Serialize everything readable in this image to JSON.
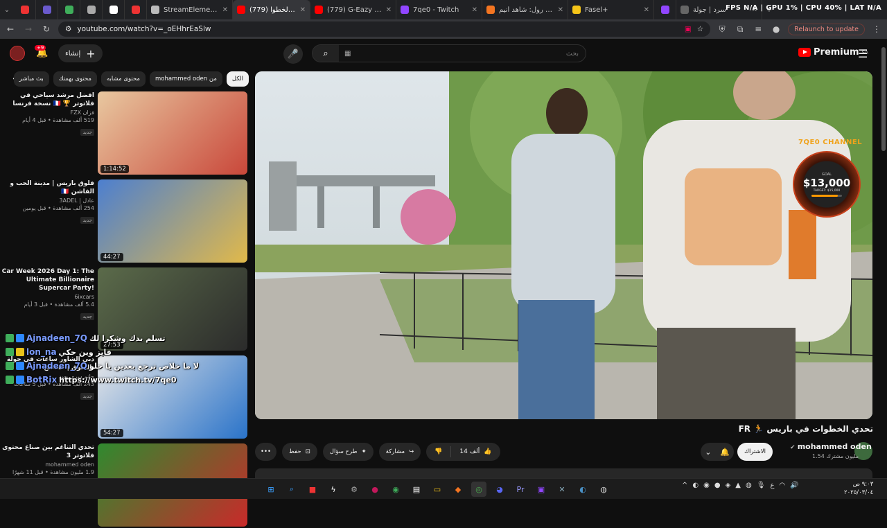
{
  "browser": {
    "tabs": [
      {
        "label": "",
        "fav": "#e33"
      },
      {
        "label": "",
        "fav": "#6a5acd"
      },
      {
        "label": "",
        "fav": "#3fae5b"
      },
      {
        "label": "",
        "fav": "#aaa"
      },
      {
        "label": "",
        "fav": "#fff"
      },
      {
        "label": "",
        "fav": "#e33"
      },
      {
        "label": "StreamElements - 7qe0",
        "fav": "#bbb"
      },
      {
        "label": "(779) تحدي الخطوا",
        "fav": "#f00",
        "active": true
      },
      {
        "label": "(779) G-Eazy x Bebe R",
        "fav": "#f00"
      },
      {
        "label": "7qe0 - Twitch",
        "fav": "#9146ff"
      },
      {
        "label": "كرانشي رول: شاهد أنيم",
        "fav": "#f47521"
      },
      {
        "label": "Fasel+",
        "fav": "#f5c518"
      },
      {
        "label": "",
        "fav": "#9146ff"
      },
      {
        "label": "سرد | جولة",
        "fav": "#666"
      }
    ],
    "osd": "FPS N/A | GPU 1% | CPU 40% | LAT N/A",
    "url": "youtube.com/watch?v=_oEHhrEaSlw",
    "relaunch": "Relaunch to update"
  },
  "header": {
    "create_label": "إنشاء",
    "notif_count": "+9",
    "search_placeholder": "بحث",
    "logo_text": "Premium",
    "logo_region": "SA"
  },
  "chips": [
    "الكل",
    "من mohammed oden",
    "محتوى مشابه",
    "محتوى بهمتك",
    "بث مباشر"
  ],
  "recs": [
    {
      "title": "افضل مرشد سياحي في فلاتوتر 🏆 🇫🇷 نسخة فرنسا",
      "channel": "فزان FZX",
      "stats": "519 ألف مشاهدة • قبل 4 أيام",
      "badge": "جديد",
      "duration": "1:14:52"
    },
    {
      "title": "فلوق باريس | مدينة الحب و الفاشن 🇫🇷",
      "channel": "عادل | 3ADEL",
      "stats": "254 ألف مشاهدة • قبل يومين",
      "badge": "جديد",
      "duration": "44:27"
    },
    {
      "title": "Car Week 2026 Day 1: The Ultimate Billionaire Supercar Party!",
      "channel": "6ixcars",
      "stats": "5.4 ألف مشاهدة • قبل 3 أيام",
      "badge": "جديد",
      "duration": "27:53"
    },
    {
      "title": "دبي الشاور ساعات في جولة بالسوق | مقاطع",
      "channel": "حاتم سري يعود",
      "stats": "243 ألف مشاهدة • قبل 5 ساعات",
      "badge": "جديد",
      "duration": "54:27"
    },
    {
      "title": "تحدي التناغم بين صناع محتوى فلاتوتر 3",
      "channel": "mohammed oden",
      "stats": "1.9 مليون مشاهدة • قبل 11 شهرًا",
      "badge": "",
      "duration": ""
    }
  ],
  "chat": [
    {
      "user": "Ajnadeen_7Q",
      "msg": "تسلم يدك وشكرا لك"
    },
    {
      "user": "lon_na",
      "msg": "فايز وين حكي"
    },
    {
      "user": "Ajnadeen_7Q",
      "msg": "لا ما خلاص ترجع بعدين يا حلو"
    },
    {
      "user": "BotRix",
      "msg": "https://www.twitch.tv/7qe0"
    }
  ],
  "overlay": {
    "channel": "7QE0 CHANNEL",
    "goal_label": "GOAL",
    "goal_amount": "$13,000",
    "goal_target": "TARGET: $15,000",
    "goal_progress": 0.87
  },
  "video": {
    "title": "تحدي الخطوات في باريس 🏃 FR",
    "owner": "mohammed oden",
    "subs": "1.54 مليون مشترك",
    "subscribe": "الاشتراك",
    "likes": "14 ألف",
    "share": "مشاركة",
    "ask": "طرح سؤال",
    "save": "حفظ"
  },
  "clock": {
    "time": "٩:٠٣ ص",
    "date": "٢٠٢٥/٠٣/٠٤"
  }
}
